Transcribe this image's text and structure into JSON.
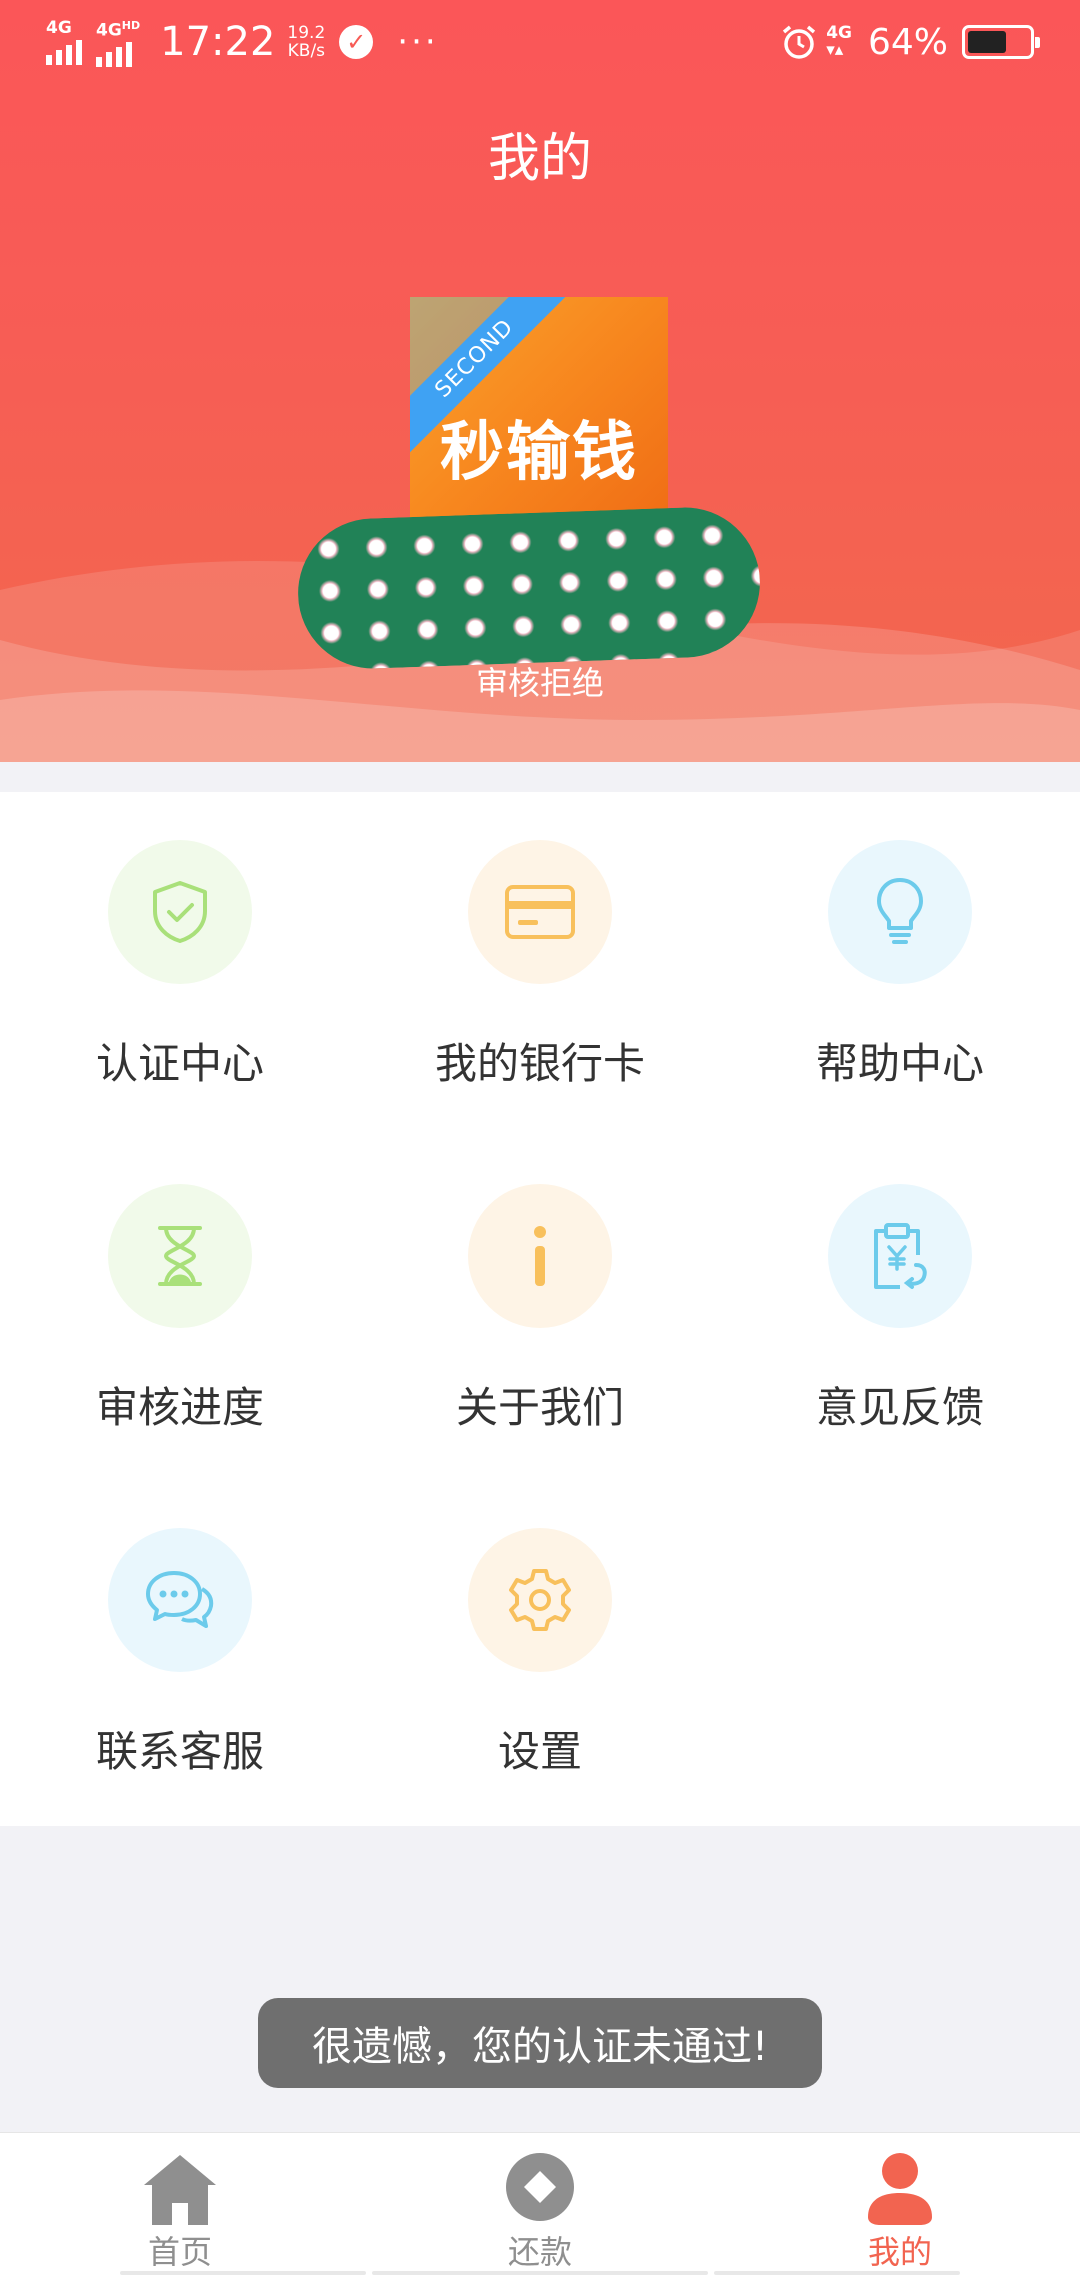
{
  "status_bar": {
    "net1": "4G",
    "net2": "4G",
    "net2_sup": "HD",
    "time": "17:22",
    "speed_value": "19.2",
    "speed_unit": "KB/s",
    "more": "···",
    "net3": "4G",
    "battery_percent": "64%",
    "battery_level": 0.64
  },
  "header": {
    "title": "我的",
    "logo_badge": "SECOND",
    "logo_text": "秒输钱",
    "review_status": "审核拒绝"
  },
  "menu": [
    {
      "label": "认证中心",
      "icon": "shield-check-icon",
      "bg": "#f1faea",
      "color": "#a9e07a"
    },
    {
      "label": "我的银行卡",
      "icon": "bank-card-icon",
      "bg": "#fef4e6",
      "color": "#f8c05c"
    },
    {
      "label": "帮助中心",
      "icon": "lightbulb-icon",
      "bg": "#e9f7fd",
      "color": "#6ccbeb"
    },
    {
      "label": "审核进度",
      "icon": "hourglass-icon",
      "bg": "#f1faea",
      "color": "#a9e07a"
    },
    {
      "label": "关于我们",
      "icon": "info-icon",
      "bg": "#fef4e6",
      "color": "#f8c05c"
    },
    {
      "label": "意见反馈",
      "icon": "clipboard-yen-icon",
      "bg": "#e9f7fd",
      "color": "#6ccbeb"
    },
    {
      "label": "联系客服",
      "icon": "chat-bubbles-icon",
      "bg": "#e9f7fd",
      "color": "#6ccbeb"
    },
    {
      "label": "设置",
      "icon": "gear-icon",
      "bg": "#fef4e6",
      "color": "#f8c05c"
    }
  ],
  "toast": "很遗憾，您的认证未通过!",
  "tabs": [
    {
      "label": "首页",
      "icon": "home-icon",
      "active": false
    },
    {
      "label": "还款",
      "icon": "repay-icon",
      "active": false
    },
    {
      "label": "我的",
      "icon": "user-icon",
      "active": true
    }
  ],
  "colors": {
    "header_top": "#fb5658",
    "header_bottom": "#f1684d",
    "active_tab": "#f26450",
    "inactive_tab": "#8f8f8f"
  }
}
